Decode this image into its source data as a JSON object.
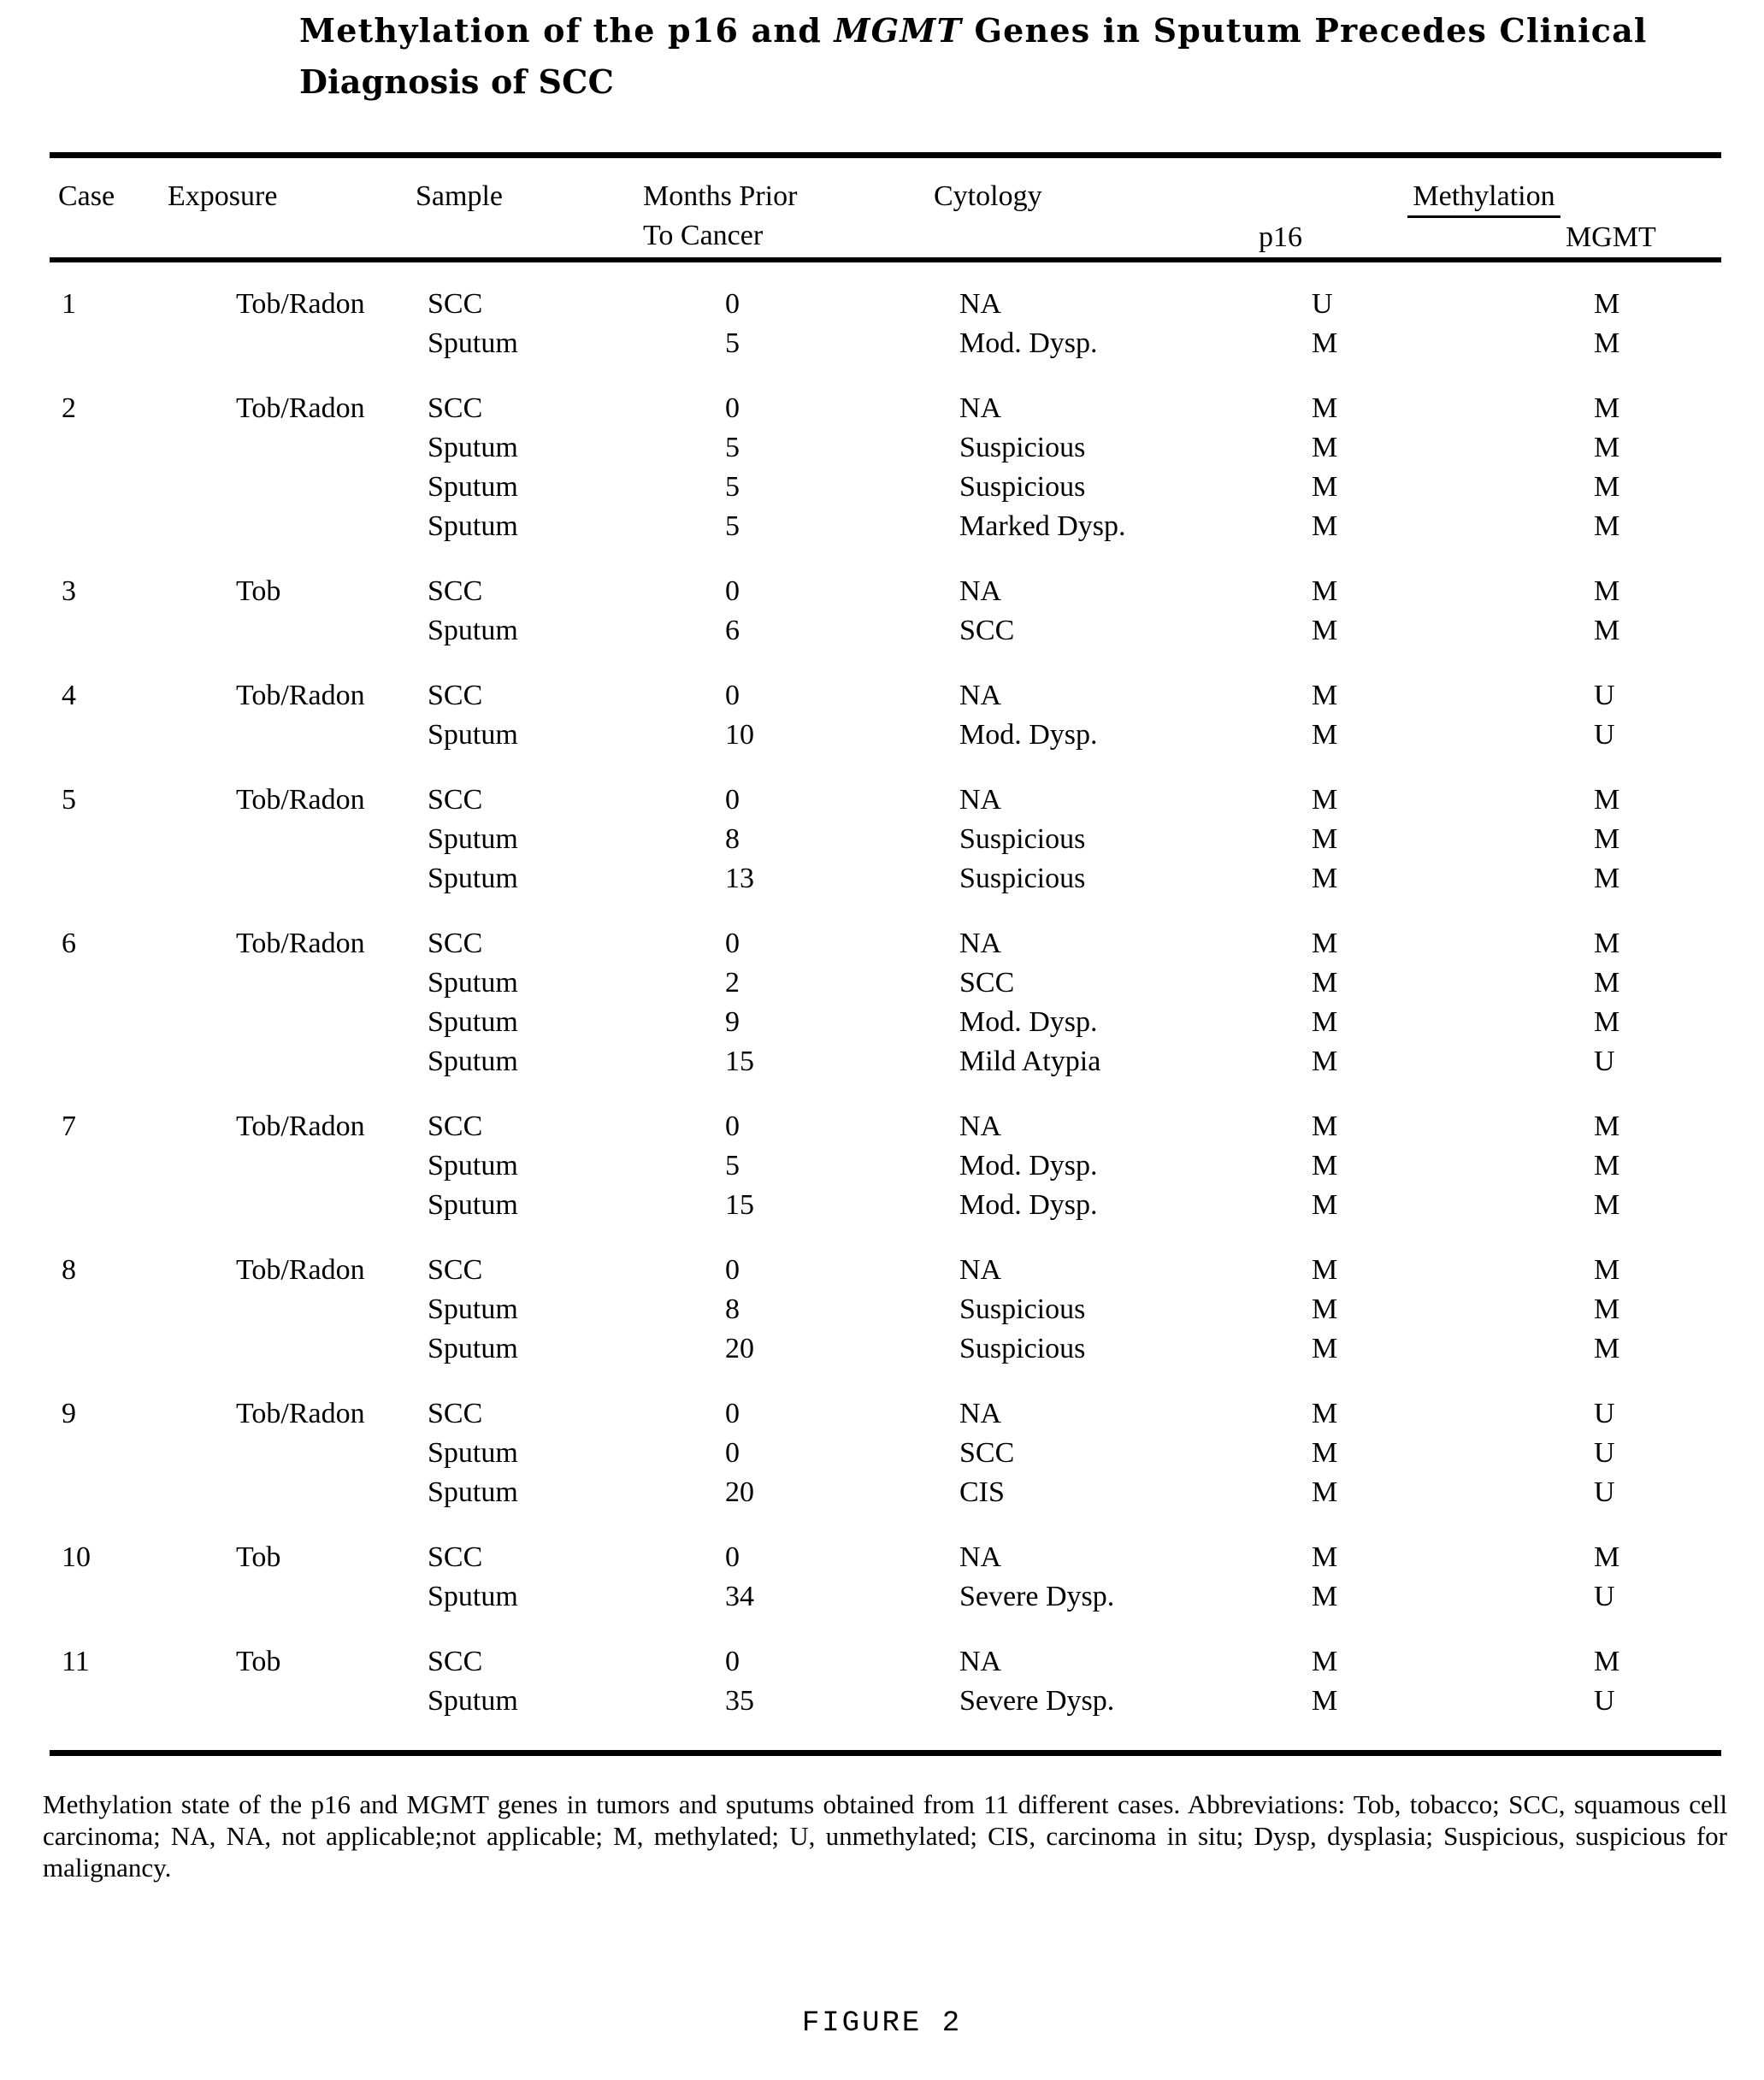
{
  "title": {
    "line1_pre": "Methylation of the p16 and ",
    "line1_italic": "MGMT",
    "line1_post": " Genes in Sputum Precedes Clinical",
    "line2": "Diagnosis of SCC",
    "full": "Methylation of the p16 and MGMT Genes in Sputum Precedes Clinical Diagnosis of SCC"
  },
  "table": {
    "headers": {
      "case": "Case",
      "exposure": "Exposure",
      "sample": "Sample",
      "months_line1": "Months Prior",
      "months_line2": "To Cancer",
      "cytology": "Cytology",
      "methylation_group": "Methylation",
      "p16": "p16",
      "mgmt": "MGMT"
    },
    "cases": [
      {
        "case": "1",
        "exposure": "Tob/Radon",
        "rows": [
          {
            "sample": "SCC",
            "months": "0",
            "cytology": "NA",
            "p16": "U",
            "mgmt": "M"
          },
          {
            "sample": "Sputum",
            "months": "5",
            "cytology": "Mod. Dysp.",
            "p16": "M",
            "mgmt": "M"
          }
        ]
      },
      {
        "case": "2",
        "exposure": "Tob/Radon",
        "rows": [
          {
            "sample": "SCC",
            "months": "0",
            "cytology": "NA",
            "p16": "M",
            "mgmt": "M"
          },
          {
            "sample": "Sputum",
            "months": "5",
            "cytology": "Suspicious",
            "p16": "M",
            "mgmt": "M"
          },
          {
            "sample": "Sputum",
            "months": "5",
            "cytology": "Suspicious",
            "p16": "M",
            "mgmt": "M"
          },
          {
            "sample": "Sputum",
            "months": "5",
            "cytology": "Marked Dysp.",
            "p16": "M",
            "mgmt": "M"
          }
        ]
      },
      {
        "case": "3",
        "exposure": "Tob",
        "rows": [
          {
            "sample": "SCC",
            "months": "0",
            "cytology": "NA",
            "p16": "M",
            "mgmt": "M"
          },
          {
            "sample": "Sputum",
            "months": "6",
            "cytology": "SCC",
            "p16": "M",
            "mgmt": "M"
          }
        ]
      },
      {
        "case": "4",
        "exposure": "Tob/Radon",
        "rows": [
          {
            "sample": "SCC",
            "months": "0",
            "cytology": "NA",
            "p16": "M",
            "mgmt": "U"
          },
          {
            "sample": "Sputum",
            "months": "10",
            "cytology": "Mod. Dysp.",
            "p16": "M",
            "mgmt": "U"
          }
        ]
      },
      {
        "case": "5",
        "exposure": "Tob/Radon",
        "rows": [
          {
            "sample": "SCC",
            "months": "0",
            "cytology": "NA",
            "p16": "M",
            "mgmt": "M"
          },
          {
            "sample": "Sputum",
            "months": "8",
            "cytology": "Suspicious",
            "p16": "M",
            "mgmt": "M"
          },
          {
            "sample": "Sputum",
            "months": "13",
            "cytology": "Suspicious",
            "p16": "M",
            "mgmt": "M"
          }
        ]
      },
      {
        "case": "6",
        "exposure": "Tob/Radon",
        "rows": [
          {
            "sample": "SCC",
            "months": "0",
            "cytology": "NA",
            "p16": "M",
            "mgmt": "M"
          },
          {
            "sample": "Sputum",
            "months": "2",
            "cytology": "SCC",
            "p16": "M",
            "mgmt": "M"
          },
          {
            "sample": "Sputum",
            "months": "9",
            "cytology": "Mod. Dysp.",
            "p16": "M",
            "mgmt": "M"
          },
          {
            "sample": "Sputum",
            "months": "15",
            "cytology": "Mild Atypia",
            "p16": "M",
            "mgmt": "U"
          }
        ]
      },
      {
        "case": "7",
        "exposure": "Tob/Radon",
        "rows": [
          {
            "sample": "SCC",
            "months": "0",
            "cytology": "NA",
            "p16": "M",
            "mgmt": "M"
          },
          {
            "sample": "Sputum",
            "months": "5",
            "cytology": "Mod. Dysp.",
            "p16": "M",
            "mgmt": "M"
          },
          {
            "sample": "Sputum",
            "months": "15",
            "cytology": "Mod. Dysp.",
            "p16": "M",
            "mgmt": "M"
          }
        ]
      },
      {
        "case": "8",
        "exposure": "Tob/Radon",
        "rows": [
          {
            "sample": "SCC",
            "months": "0",
            "cytology": "NA",
            "p16": "M",
            "mgmt": "M"
          },
          {
            "sample": "Sputum",
            "months": "8",
            "cytology": "Suspicious",
            "p16": "M",
            "mgmt": "M"
          },
          {
            "sample": "Sputum",
            "months": "20",
            "cytology": "Suspicious",
            "p16": "M",
            "mgmt": "M"
          }
        ]
      },
      {
        "case": "9",
        "exposure": "Tob/Radon",
        "rows": [
          {
            "sample": "SCC",
            "months": "0",
            "cytology": "NA",
            "p16": "M",
            "mgmt": "U"
          },
          {
            "sample": "Sputum",
            "months": "0",
            "cytology": "SCC",
            "p16": "M",
            "mgmt": "U"
          },
          {
            "sample": "Sputum",
            "months": "20",
            "cytology": "CIS",
            "p16": "M",
            "mgmt": "U"
          }
        ]
      },
      {
        "case": "10",
        "exposure": "Tob",
        "rows": [
          {
            "sample": "SCC",
            "months": "0",
            "cytology": "NA",
            "p16": "M",
            "mgmt": "M"
          },
          {
            "sample": "Sputum",
            "months": "34",
            "cytology": "Severe Dysp.",
            "p16": "M",
            "mgmt": "U"
          }
        ]
      },
      {
        "case": "11",
        "exposure": "Tob",
        "rows": [
          {
            "sample": "SCC",
            "months": "0",
            "cytology": "NA",
            "p16": "M",
            "mgmt": "M"
          },
          {
            "sample": "Sputum",
            "months": "35",
            "cytology": "Severe Dysp.",
            "p16": "M",
            "mgmt": "U"
          }
        ]
      }
    ]
  },
  "caption": {
    "text": "Methylation state of the p16 and MGMT genes in tumors and sputums obtained from 11 different cases. Abbreviations: Tob, tobacco; SCC, squamous cell carcinoma; NA, NA, not applicable;not applicable; M, methylated; U, unmethylated; CIS, carcinoma in situ; Dysp, dysplasia; Suspicious, suspicious for malignancy."
  },
  "figure_label": "FIGURE  2"
}
